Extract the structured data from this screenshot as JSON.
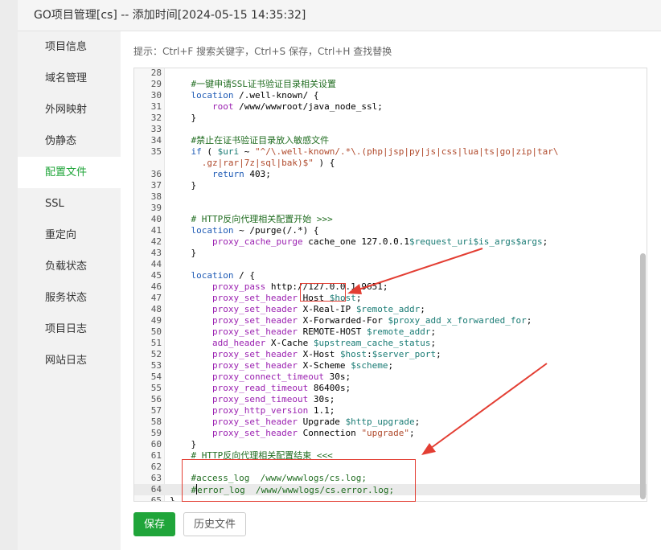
{
  "window": {
    "title": "GO项目管理[cs] -- 添加时间[2024-05-15 14:35:32]"
  },
  "sidebar": {
    "items": [
      {
        "label": "项目信息"
      },
      {
        "label": "域名管理"
      },
      {
        "label": "外网映射"
      },
      {
        "label": "伪静态"
      },
      {
        "label": "配置文件",
        "active": true
      },
      {
        "label": "SSL"
      },
      {
        "label": "重定向"
      },
      {
        "label": "负载状态"
      },
      {
        "label": "服务状态"
      },
      {
        "label": "项目日志"
      },
      {
        "label": "网站日志"
      }
    ]
  },
  "editor": {
    "tip": "提示：Ctrl+F 搜索关键字，Ctrl+S 保存，Ctrl+H 查找替换",
    "lines": [
      {
        "n": "28",
        "indent": 0,
        "parts": []
      },
      {
        "n": "29",
        "indent": 1,
        "parts": [
          {
            "t": "#一键申请SSL证书验证目录相关设置",
            "c": "cm"
          }
        ]
      },
      {
        "n": "30",
        "indent": 1,
        "parts": [
          {
            "t": "location",
            "c": "kw"
          },
          {
            "t": " /.well-known/ {",
            "c": ""
          }
        ]
      },
      {
        "n": "31",
        "indent": 2,
        "parts": [
          {
            "t": "root",
            "c": "dir"
          },
          {
            "t": " /www/wwwroot/java_node_ssl;",
            "c": ""
          }
        ]
      },
      {
        "n": "32",
        "indent": 1,
        "parts": [
          {
            "t": "}",
            "c": ""
          }
        ]
      },
      {
        "n": "33",
        "indent": 0,
        "parts": []
      },
      {
        "n": "34",
        "indent": 1,
        "parts": [
          {
            "t": "#禁止在证书验证目录放入敏感文件",
            "c": "cm"
          }
        ]
      },
      {
        "n": "35",
        "indent": 1,
        "parts": [
          {
            "t": "if",
            "c": "kw"
          },
          {
            "t": " ( ",
            "c": ""
          },
          {
            "t": "$uri",
            "c": "var"
          },
          {
            "t": " ~ ",
            "c": ""
          },
          {
            "t": "\"^/\\.well-known/.*\\.(php|jsp|py|js|css|lua|ts|go|zip|tar\\",
            "c": "str"
          }
        ]
      },
      {
        "n": "",
        "indent": 1,
        "pad": "  ",
        "parts": [
          {
            "t": ".gz|rar|7z|sql|bak)$\"",
            "c": "str"
          },
          {
            "t": " ) {",
            "c": ""
          }
        ]
      },
      {
        "n": "36",
        "indent": 2,
        "parts": [
          {
            "t": "return",
            "c": "kw"
          },
          {
            "t": " 403;",
            "c": ""
          }
        ]
      },
      {
        "n": "37",
        "indent": 1,
        "parts": [
          {
            "t": "}",
            "c": ""
          }
        ]
      },
      {
        "n": "38",
        "indent": 0,
        "parts": []
      },
      {
        "n": "39",
        "indent": 0,
        "parts": []
      },
      {
        "n": "40",
        "indent": 1,
        "parts": [
          {
            "t": "# HTTP反向代理相关配置开始 >>>",
            "c": "cm"
          }
        ]
      },
      {
        "n": "41",
        "indent": 1,
        "parts": [
          {
            "t": "location",
            "c": "kw"
          },
          {
            "t": " ~ /purge(/.*) {",
            "c": ""
          }
        ]
      },
      {
        "n": "42",
        "indent": 2,
        "parts": [
          {
            "t": "proxy_cache_purge",
            "c": "dir"
          },
          {
            "t": " cache_one 127.0.0.1",
            "c": ""
          },
          {
            "t": "$request_uri",
            "c": "var"
          },
          {
            "t": "$is_args",
            "c": "var"
          },
          {
            "t": "$args",
            "c": "var"
          },
          {
            "t": ";",
            "c": ""
          }
        ]
      },
      {
        "n": "43",
        "indent": 1,
        "parts": [
          {
            "t": "}",
            "c": ""
          }
        ]
      },
      {
        "n": "44",
        "indent": 0,
        "parts": []
      },
      {
        "n": "45",
        "indent": 1,
        "parts": [
          {
            "t": "location",
            "c": "kw"
          },
          {
            "t": " / {",
            "c": ""
          }
        ]
      },
      {
        "n": "46",
        "indent": 2,
        "parts": [
          {
            "t": "proxy_pass",
            "c": "dir"
          },
          {
            "t": " http://127.0.0.1:9651;",
            "c": ""
          }
        ]
      },
      {
        "n": "47",
        "indent": 2,
        "parts": [
          {
            "t": "proxy_set_header",
            "c": "dir"
          },
          {
            "t": " Host ",
            "c": ""
          },
          {
            "t": "$host",
            "c": "var"
          },
          {
            "t": ";",
            "c": ""
          }
        ]
      },
      {
        "n": "48",
        "indent": 2,
        "parts": [
          {
            "t": "proxy_set_header",
            "c": "dir"
          },
          {
            "t": " X-Real-IP ",
            "c": ""
          },
          {
            "t": "$remote_addr",
            "c": "var"
          },
          {
            "t": ";",
            "c": ""
          }
        ]
      },
      {
        "n": "49",
        "indent": 2,
        "parts": [
          {
            "t": "proxy_set_header",
            "c": "dir"
          },
          {
            "t": " X-Forwarded-For ",
            "c": ""
          },
          {
            "t": "$proxy_add_x_forwarded_for",
            "c": "var"
          },
          {
            "t": ";",
            "c": ""
          }
        ]
      },
      {
        "n": "50",
        "indent": 2,
        "parts": [
          {
            "t": "proxy_set_header",
            "c": "dir"
          },
          {
            "t": " REMOTE-HOST ",
            "c": ""
          },
          {
            "t": "$remote_addr",
            "c": "var"
          },
          {
            "t": ";",
            "c": ""
          }
        ]
      },
      {
        "n": "51",
        "indent": 2,
        "parts": [
          {
            "t": "add_header",
            "c": "dir"
          },
          {
            "t": " X-Cache ",
            "c": ""
          },
          {
            "t": "$upstream_cache_status",
            "c": "var"
          },
          {
            "t": ";",
            "c": ""
          }
        ]
      },
      {
        "n": "52",
        "indent": 2,
        "parts": [
          {
            "t": "proxy_set_header",
            "c": "dir"
          },
          {
            "t": " X-Host ",
            "c": ""
          },
          {
            "t": "$host",
            "c": "var"
          },
          {
            "t": ":",
            "c": ""
          },
          {
            "t": "$server_port",
            "c": "var"
          },
          {
            "t": ";",
            "c": ""
          }
        ]
      },
      {
        "n": "53",
        "indent": 2,
        "parts": [
          {
            "t": "proxy_set_header",
            "c": "dir"
          },
          {
            "t": " X-Scheme ",
            "c": ""
          },
          {
            "t": "$scheme",
            "c": "var"
          },
          {
            "t": ";",
            "c": ""
          }
        ]
      },
      {
        "n": "54",
        "indent": 2,
        "parts": [
          {
            "t": "proxy_connect_timeout",
            "c": "dir"
          },
          {
            "t": " 30s;",
            "c": ""
          }
        ]
      },
      {
        "n": "55",
        "indent": 2,
        "parts": [
          {
            "t": "proxy_read_timeout",
            "c": "dir"
          },
          {
            "t": " 86400s;",
            "c": ""
          }
        ]
      },
      {
        "n": "56",
        "indent": 2,
        "parts": [
          {
            "t": "proxy_send_timeout",
            "c": "dir"
          },
          {
            "t": " 30s;",
            "c": ""
          }
        ]
      },
      {
        "n": "57",
        "indent": 2,
        "parts": [
          {
            "t": "proxy_http_version",
            "c": "dir"
          },
          {
            "t": " 1.1;",
            "c": ""
          }
        ]
      },
      {
        "n": "58",
        "indent": 2,
        "parts": [
          {
            "t": "proxy_set_header",
            "c": "dir"
          },
          {
            "t": " Upgrade ",
            "c": ""
          },
          {
            "t": "$http_upgrade",
            "c": "var"
          },
          {
            "t": ";",
            "c": ""
          }
        ]
      },
      {
        "n": "59",
        "indent": 2,
        "parts": [
          {
            "t": "proxy_set_header",
            "c": "dir"
          },
          {
            "t": " Connection ",
            "c": ""
          },
          {
            "t": "\"upgrade\"",
            "c": "str"
          },
          {
            "t": ";",
            "c": ""
          }
        ]
      },
      {
        "n": "60",
        "indent": 1,
        "parts": [
          {
            "t": "}",
            "c": ""
          }
        ]
      },
      {
        "n": "61",
        "indent": 1,
        "parts": [
          {
            "t": "# HTTP反向代理相关配置结束 <<<",
            "c": "cm"
          }
        ]
      },
      {
        "n": "62",
        "indent": 0,
        "parts": []
      },
      {
        "n": "63",
        "indent": 1,
        "parts": [
          {
            "t": "#access_log  /www/wwwlogs/cs.log;",
            "c": "cm"
          }
        ]
      },
      {
        "n": "64",
        "indent": 1,
        "cursor": true,
        "highlight": true,
        "parts": [
          {
            "t": "#",
            "c": "cm"
          },
          {
            "t": "error_log  /www/wwwlogs/cs.error.log;",
            "c": "cm"
          }
        ]
      },
      {
        "n": "65",
        "indent": 0,
        "parts": [
          {
            "t": "}",
            "c": ""
          }
        ]
      }
    ]
  },
  "buttons": {
    "save": "保存",
    "history": "历史文件"
  }
}
